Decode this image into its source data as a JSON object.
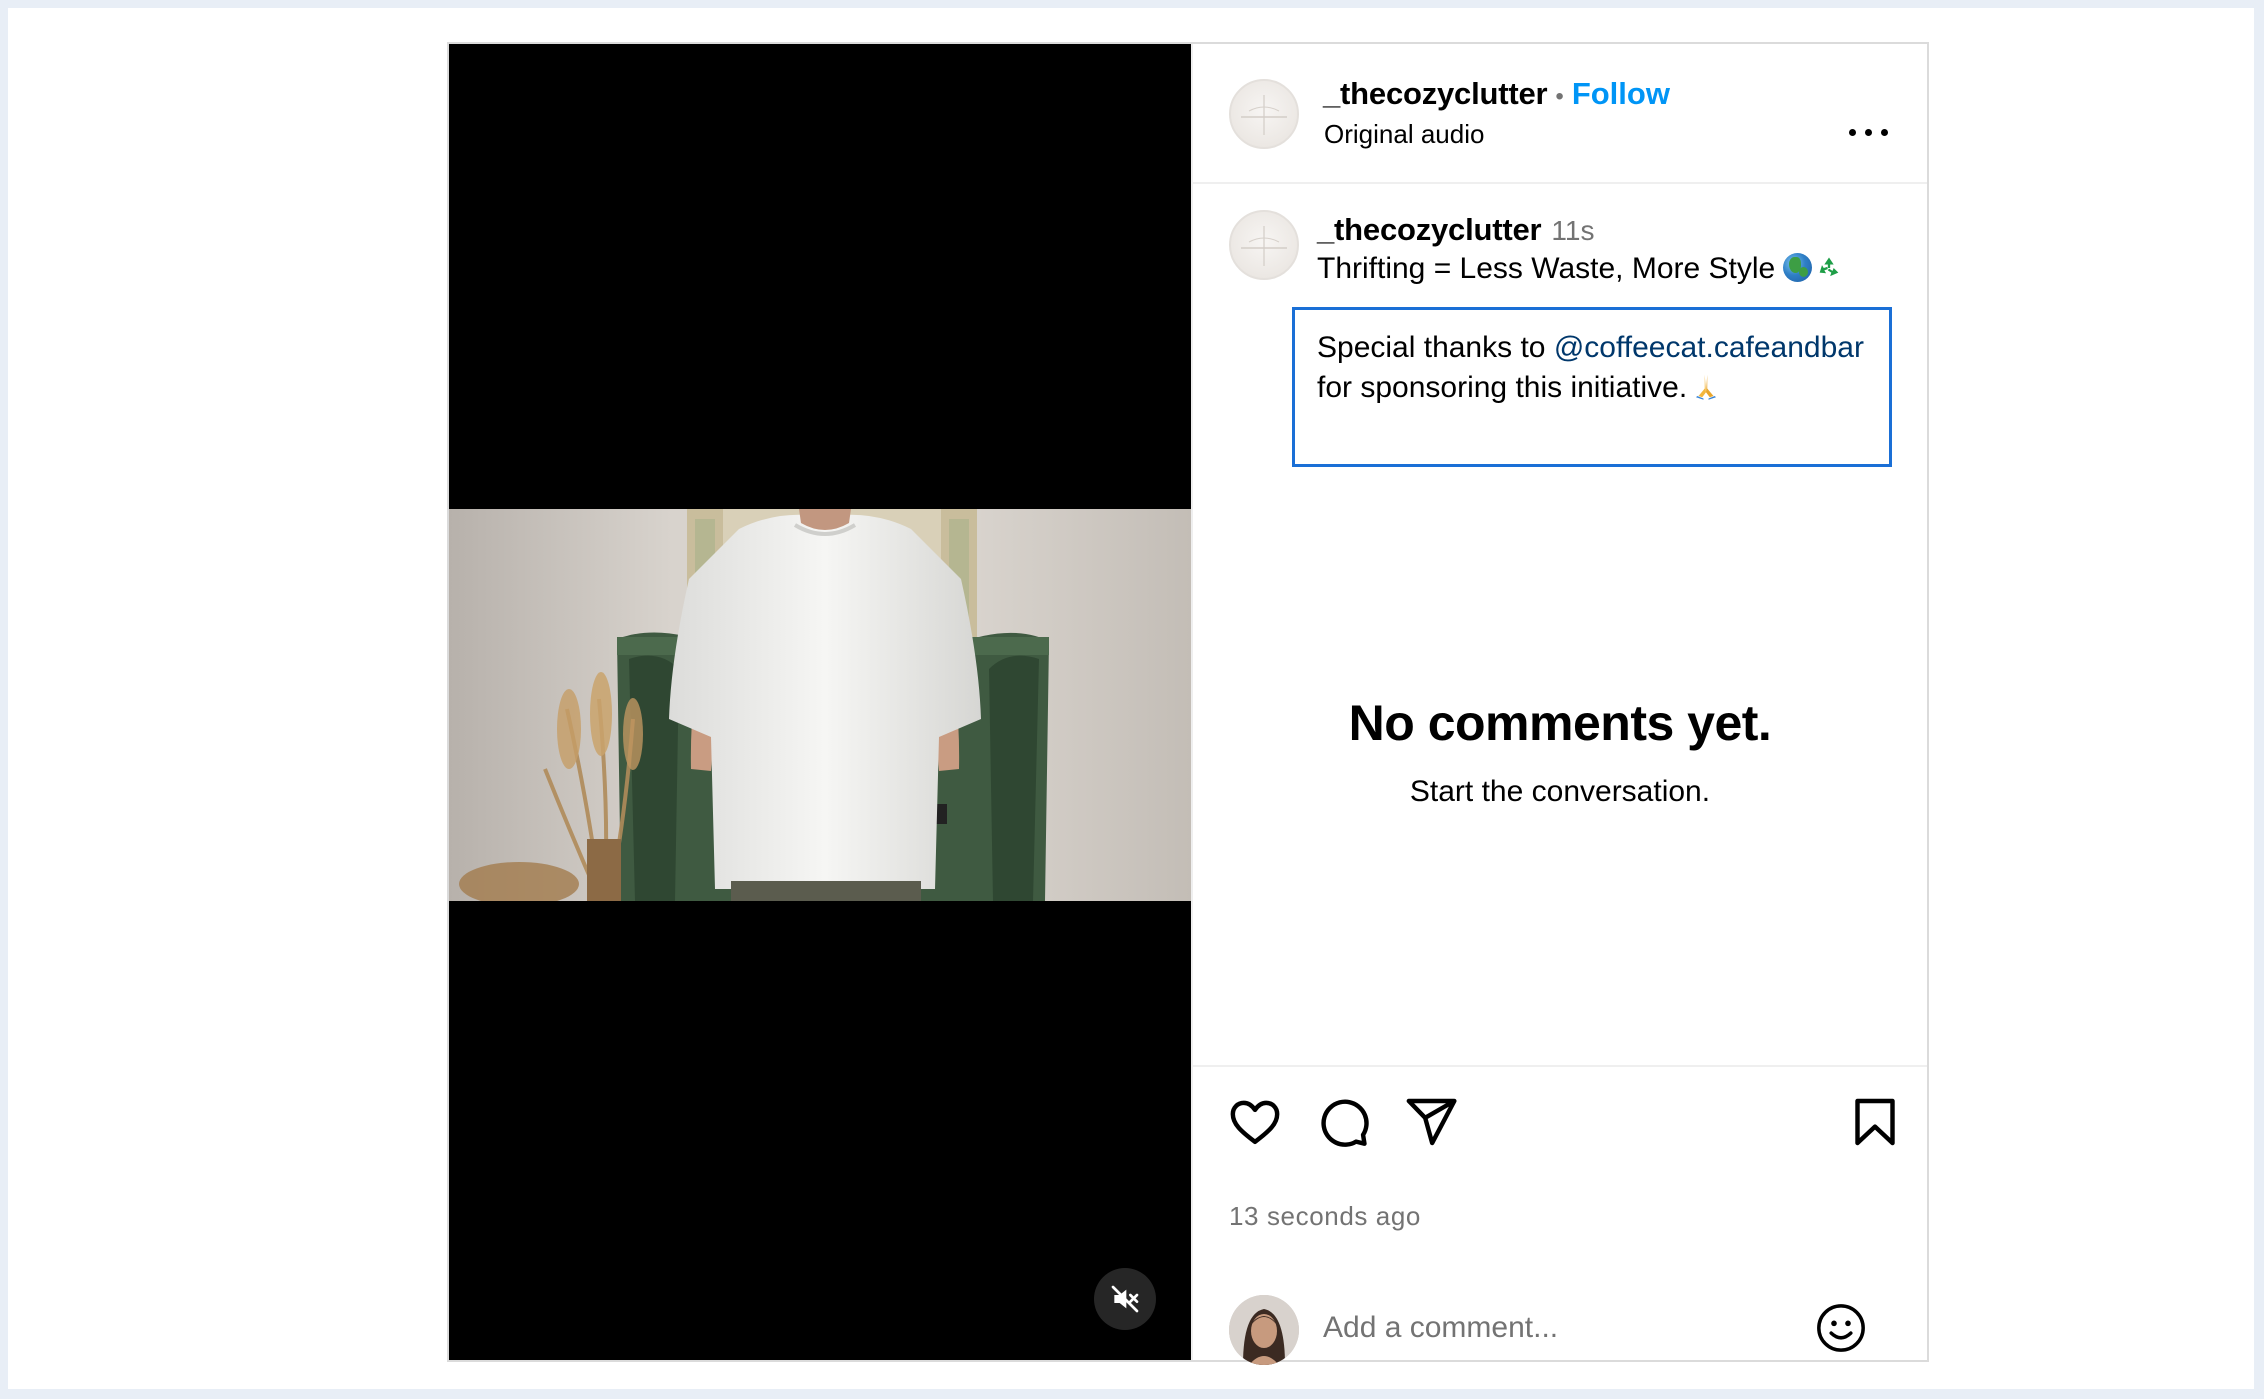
{
  "post": {
    "media": {
      "mute_icon": "speaker-muted-icon"
    },
    "header": {
      "username": "_thecozyclutter",
      "separator": "•",
      "follow_label": "Follow",
      "audio_label": "Original audio",
      "more_icon": "more-horizontal-icon"
    },
    "caption": {
      "username": "_thecozyclutter",
      "time": "11s",
      "line1": "Thrifting = Less Waste, More Style",
      "body_prefix": "Special thanks to",
      "mention": "@coffeecat.cafeandbar",
      "body_suffix": "for sponsoring this initiative."
    },
    "empty_state": {
      "title": "No comments yet.",
      "subtitle": "Start the conversation."
    },
    "actions": {
      "like_icon": "heart-icon",
      "comment_icon": "comment-icon",
      "share_icon": "send-icon",
      "save_icon": "bookmark-icon",
      "timestamp": "13 seconds ago"
    },
    "comment_box": {
      "placeholder": "Add a comment...",
      "emoji_icon": "emoji-icon"
    }
  },
  "colors": {
    "follow_blue": "#0095f6",
    "mention_blue": "#00376b",
    "highlight_border": "#1a6fd6",
    "secondary_text": "#737373"
  }
}
